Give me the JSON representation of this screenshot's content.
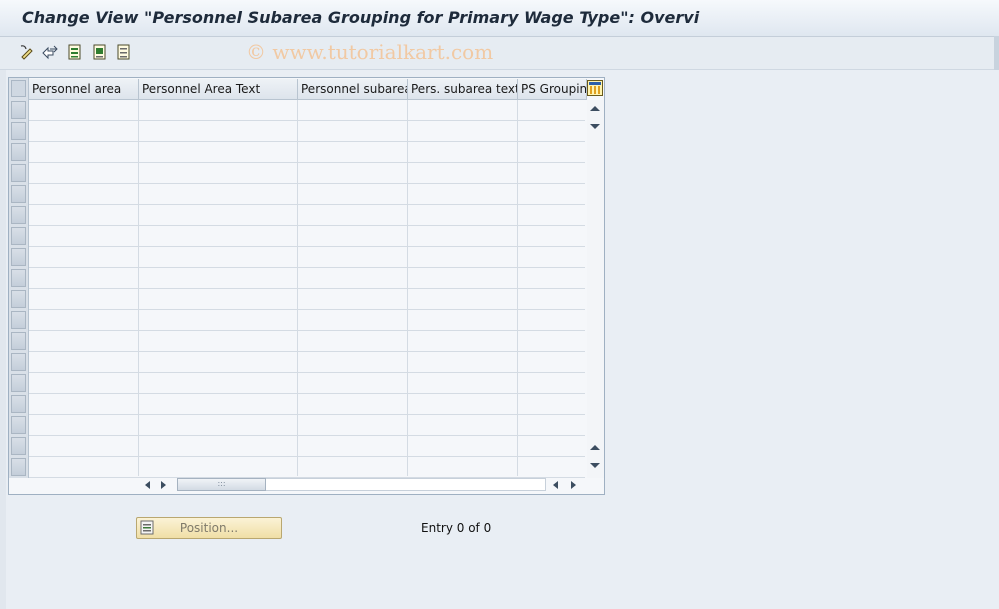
{
  "title": "Change View \"Personnel Subarea Grouping for Primary Wage Type\": Overvi",
  "watermark": "© www.tutorialkart.com",
  "toolbar": {
    "icons": [
      "display-change-icon",
      "other-view-icon",
      "select-all-icon",
      "select-block-icon",
      "deselect-all-icon"
    ]
  },
  "table": {
    "columns": [
      "Personnel area",
      "Personnel Area Text",
      "Personnel subarea",
      "Pers. subarea text",
      "PS Grouping"
    ],
    "rows": [
      [
        "",
        "",
        "",
        "",
        ""
      ],
      [
        "",
        "",
        "",
        "",
        ""
      ],
      [
        "",
        "",
        "",
        "",
        ""
      ],
      [
        "",
        "",
        "",
        "",
        ""
      ],
      [
        "",
        "",
        "",
        "",
        ""
      ],
      [
        "",
        "",
        "",
        "",
        ""
      ],
      [
        "",
        "",
        "",
        "",
        ""
      ],
      [
        "",
        "",
        "",
        "",
        ""
      ],
      [
        "",
        "",
        "",
        "",
        ""
      ],
      [
        "",
        "",
        "",
        "",
        ""
      ],
      [
        "",
        "",
        "",
        "",
        ""
      ],
      [
        "",
        "",
        "",
        "",
        ""
      ],
      [
        "",
        "",
        "",
        "",
        ""
      ],
      [
        "",
        "",
        "",
        "",
        ""
      ],
      [
        "",
        "",
        "",
        "",
        ""
      ],
      [
        "",
        "",
        "",
        "",
        ""
      ],
      [
        "",
        "",
        "",
        "",
        ""
      ],
      [
        "",
        "",
        "",
        "",
        ""
      ]
    ]
  },
  "position_button": "Position...",
  "entry_text": "Entry 0 of 0",
  "colors": {
    "title_text": "#1e2b3b",
    "background": "#e9eef4",
    "button_fill": "#f0dfa6"
  }
}
